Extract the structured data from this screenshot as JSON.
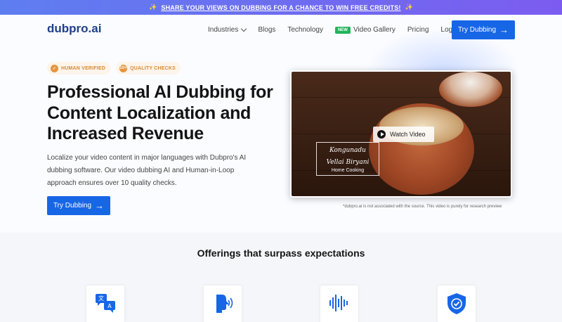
{
  "banner": {
    "text": "SHARE YOUR VIEWS ON DUBBING FOR A CHANCE TO WIN FREE CREDITS!",
    "sparkle": "✨"
  },
  "nav": {
    "logo": "dubpro.ai",
    "links": [
      {
        "label": "Industries"
      },
      {
        "label": "Blogs"
      },
      {
        "label": "Technology"
      },
      {
        "label": "Video Gallery",
        "tag": "NEW"
      },
      {
        "label": "Pricing"
      },
      {
        "label": "Login"
      }
    ],
    "cta": "Try Dubbing"
  },
  "hero": {
    "badges": [
      {
        "label": "HUMAN VERIFIED",
        "icon": "✓"
      },
      {
        "label": "QUALITY CHECKS",
        "icon": "10+"
      }
    ],
    "headline": "Professional AI Dubbing for Content Localization and Increased Revenue",
    "description": "Localize your video content in major languages with Dubpro's AI dubbing software. Our video dubbing AI and Human-in-Loop approach ensures over 10 quality checks.",
    "cta": "Try Dubbing",
    "video": {
      "watch_label": "Watch Video",
      "caption_line1": "Kongunadu",
      "caption_line2": "Vellai Biryani",
      "caption_line3": "Home Cooking"
    },
    "disclaimer": "*dubpro.ai is not associated with the source. This video is purely for research preview"
  },
  "offerings": {
    "title": "Offerings that surpass expectations",
    "cards": [
      {
        "icon": "translate-chat-icon"
      },
      {
        "icon": "voice-profile-icon"
      },
      {
        "icon": "audio-waveform-icon"
      },
      {
        "icon": "shield-check-icon"
      }
    ]
  },
  "colors": {
    "primary": "#1766e6",
    "logo": "#1f3f8a",
    "badge": "#e3953f",
    "new_tag": "#22b35b"
  }
}
